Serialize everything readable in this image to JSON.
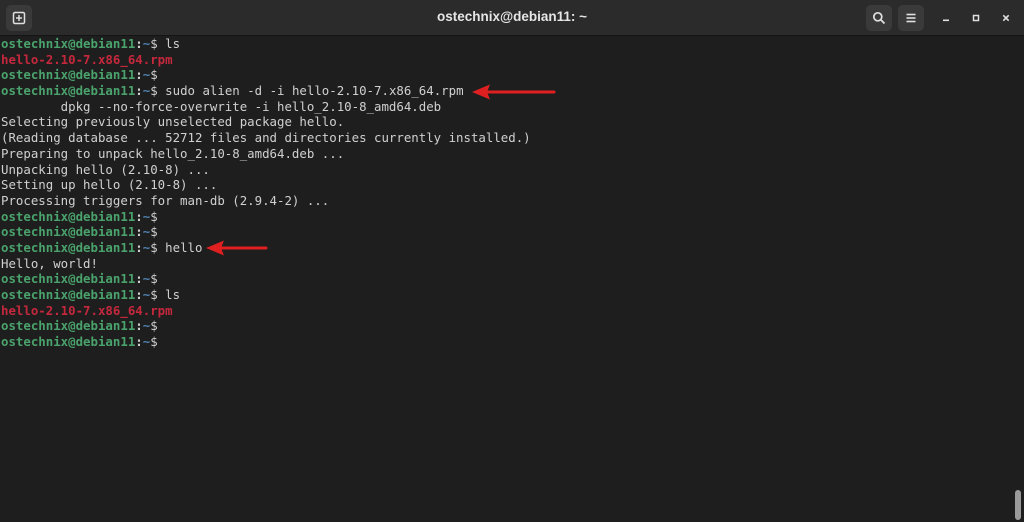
{
  "window": {
    "title": "ostechnix@debian11: ~"
  },
  "prompt": {
    "user_host": "ostechnix@debian11",
    "sep": ":",
    "path": "~",
    "dollar": "$"
  },
  "terminal": {
    "lines": [
      {
        "type": "prompt",
        "cmd": " ls"
      },
      {
        "type": "output",
        "text": "hello-2.10-7.x86_64.rpm",
        "style": "red"
      },
      {
        "type": "prompt",
        "cmd": ""
      },
      {
        "type": "prompt",
        "cmd": " sudo alien -d -i hello-2.10-7.x86_64.rpm"
      },
      {
        "type": "output",
        "text": "        dpkg --no-force-overwrite -i hello_2.10-8_amd64.deb",
        "style": "plain"
      },
      {
        "type": "output",
        "text": "Selecting previously unselected package hello.",
        "style": "plain"
      },
      {
        "type": "output",
        "text": "(Reading database ... 52712 files and directories currently installed.)",
        "style": "plain"
      },
      {
        "type": "output",
        "text": "Preparing to unpack hello_2.10-8_amd64.deb ...",
        "style": "plain"
      },
      {
        "type": "output",
        "text": "Unpacking hello (2.10-8) ...",
        "style": "plain"
      },
      {
        "type": "output",
        "text": "Setting up hello (2.10-8) ...",
        "style": "plain"
      },
      {
        "type": "output",
        "text": "Processing triggers for man-db (2.9.4-2) ...",
        "style": "plain"
      },
      {
        "type": "prompt",
        "cmd": ""
      },
      {
        "type": "prompt",
        "cmd": ""
      },
      {
        "type": "prompt",
        "cmd": " hello"
      },
      {
        "type": "output",
        "text": "Hello, world!",
        "style": "plain"
      },
      {
        "type": "prompt",
        "cmd": ""
      },
      {
        "type": "prompt",
        "cmd": " ls"
      },
      {
        "type": "output",
        "text": "hello-2.10-7.x86_64.rpm",
        "style": "red"
      },
      {
        "type": "prompt",
        "cmd": ""
      },
      {
        "type": "prompt",
        "cmd": ""
      }
    ]
  },
  "icons": {
    "new_tab": "new-tab-icon",
    "search": "search-icon",
    "menu": "hamburger-menu-icon",
    "minimize": "minimize-icon",
    "maximize": "maximize-icon",
    "close": "close-icon"
  },
  "colors": {
    "background": "#1e1e1e",
    "titlebar": "#2b2b2b",
    "prompt_user": "#4aa26c",
    "prompt_path": "#4f7fb0",
    "rpm_file": "#c5283d",
    "annotation_arrow": "#e02020"
  }
}
